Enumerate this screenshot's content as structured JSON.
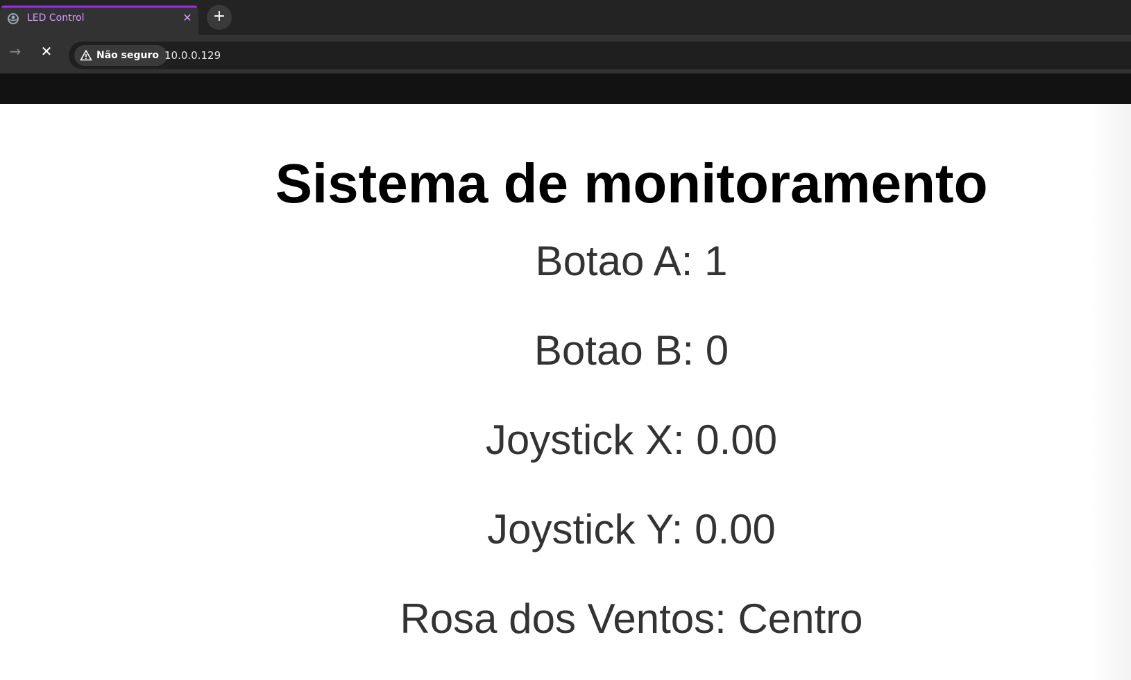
{
  "browser": {
    "tab": {
      "title": "LED Control",
      "close_glyph": "✕",
      "favicon": "globe-icon",
      "accent_color": "#9b2ee6"
    },
    "new_tab_glyph": "+",
    "toolbar": {
      "forward_glyph": "→",
      "stop_glyph": "✕",
      "security_label": "Não seguro",
      "security_icon": "warning-triangle-icon",
      "url": "10.0.0.129"
    }
  },
  "page": {
    "title": "Sistema de monitoramento",
    "readings": [
      {
        "label": "Botao A",
        "value": "1",
        "text": "Botao A: 1"
      },
      {
        "label": "Botao B",
        "value": "0",
        "text": "Botao B: 0"
      },
      {
        "label": "Joystick X",
        "value": "0.00",
        "text": "Joystick X: 0.00"
      },
      {
        "label": "Joystick Y",
        "value": "0.00",
        "text": "Joystick Y: 0.00"
      },
      {
        "label": "Rosa dos Ventos",
        "value": "Centro",
        "text": "Rosa dos Ventos: Centro"
      }
    ]
  }
}
